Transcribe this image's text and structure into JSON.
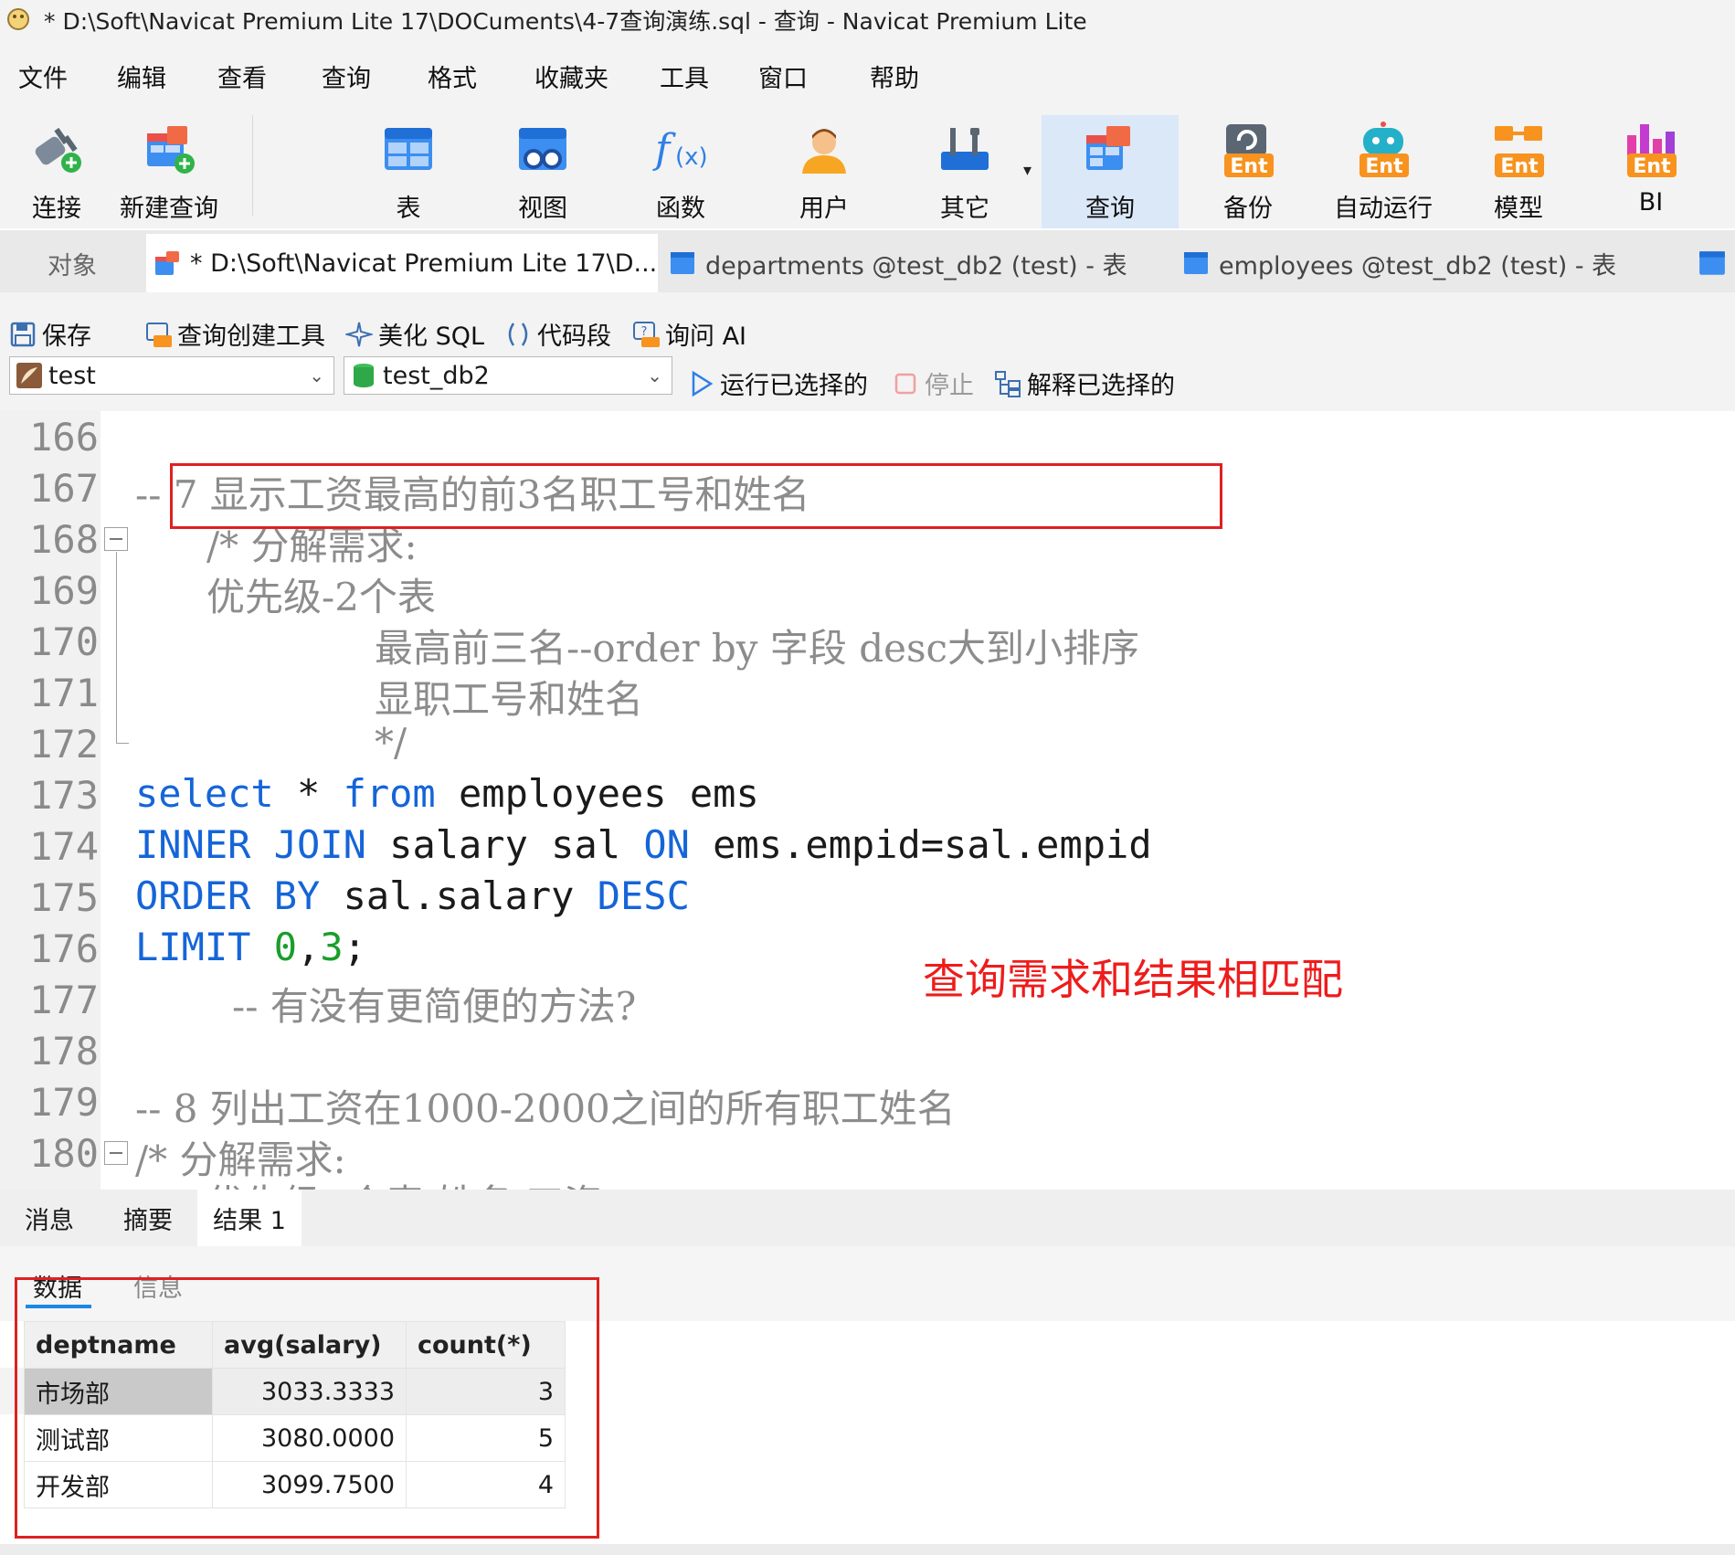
{
  "window": {
    "title": "* D:\\Soft\\Navicat Premium Lite 17\\DOCuments\\4-7查询演练.sql - 查询 - Navicat Premium Lite"
  },
  "menu": [
    "文件",
    "编辑",
    "查看",
    "查询",
    "格式",
    "收藏夹",
    "工具",
    "窗口",
    "帮助"
  ],
  "toolbar": {
    "items": [
      {
        "label": "连接",
        "icon": "plug-icon"
      },
      {
        "label": "新建查询",
        "icon": "new-query-icon"
      },
      {
        "label": "表",
        "icon": "table-icon"
      },
      {
        "label": "视图",
        "icon": "view-icon"
      },
      {
        "label": "函数",
        "icon": "function-icon"
      },
      {
        "label": "用户",
        "icon": "user-icon"
      },
      {
        "label": "其它",
        "icon": "tools-icon"
      },
      {
        "label": "查询",
        "icon": "query-icon"
      },
      {
        "label": "备份",
        "icon": "backup-icon"
      },
      {
        "label": "自动运行",
        "icon": "robot-icon"
      },
      {
        "label": "模型",
        "icon": "model-icon"
      },
      {
        "label": "BI",
        "icon": "bi-icon"
      }
    ],
    "badge": "Ent"
  },
  "tabs": {
    "objects": "对象",
    "query_tab": "* D:\\Soft\\Navicat Premium Lite 17\\D...",
    "departments_tab": "departments @test_db2 (test) - 表",
    "employees_tab": "employees @test_db2 (test) - 表"
  },
  "query_toolbar": {
    "save": "保存",
    "builder": "查询创建工具",
    "beautify": "美化 SQL",
    "snippet": "代码段",
    "ask_ai": "询问 AI",
    "connection": "test",
    "database": "test_db2",
    "run_selected": "运行已选择的",
    "stop": "停止",
    "explain": "解释已选择的"
  },
  "editor": {
    "line_numbers": [
      "166",
      "167",
      "168",
      "169",
      "170",
      "171",
      "172",
      "173",
      "174",
      "175",
      "176",
      "177",
      "178",
      "179",
      "180"
    ],
    "lines": {
      "l167": "-- 7 显示工资最高的前3名职工号和姓名",
      "l168": "/* 分解需求:",
      "l169": "优先级-2个表",
      "l170": "最高前三名--order by 字段 desc大到小排序",
      "l171": "显职工号和姓名",
      "l172": "*/",
      "l173_kw1": "select",
      "l173_mid": " * ",
      "l173_kw2": "from",
      "l173_rest": " employees ems",
      "l174_kw1": "INNER JOIN",
      "l174_mid": " salary sal ",
      "l174_kw2": "ON",
      "l174_rest": " ems.empid=sal.empid",
      "l175_kw1": "ORDER BY",
      "l175_mid": " sal.salary ",
      "l175_kw2": "DESC",
      "l176_kw": "LIMIT",
      "l176_n1": "0",
      "l176_comma": ",",
      "l176_n2": "3",
      "l176_semi": ";",
      "l177": "-- 有没有更简便的方法?",
      "l179": "-- 8 列出工资在1000-2000之间的所有职工姓名",
      "l180": "/* 分解需求:",
      "l181_partial": "优先级--个表 姓名 工资"
    },
    "annotation": "查询需求和结果相匹配"
  },
  "result_tabs": [
    "消息",
    "摘要",
    "结果 1"
  ],
  "result_subtabs": [
    "数据",
    "信息"
  ],
  "table": {
    "columns": [
      "deptname",
      "avg(salary)",
      "count(*)"
    ],
    "rows": [
      [
        "市场部",
        "3033.3333",
        "3"
      ],
      [
        "测试部",
        "3080.0000",
        "5"
      ],
      [
        "开发部",
        "3099.7500",
        "4"
      ]
    ]
  },
  "colors": {
    "keyword": "#1565d8",
    "comment": "#8c8c8c",
    "number": "#1a9e2a",
    "annotation": "#ee1c1c",
    "highlight_box": "#e02020"
  }
}
